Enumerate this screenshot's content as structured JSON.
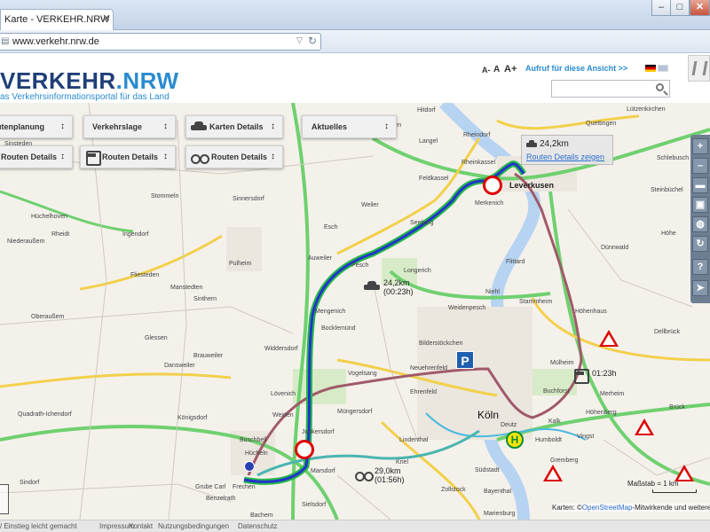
{
  "browser": {
    "tab_title": "Karte - VERKEHR.NRW",
    "tab_close": "✕",
    "url": "www.verkehr.nrw.de",
    "window_buttons": {
      "minimize": "–",
      "maximize": "□",
      "close": "✕"
    }
  },
  "header": {
    "logo_main": "VERKEHR",
    "logo_accent": ".NRW",
    "logo_sub": "as Verkehrsinformationsportal für das Land",
    "font_sizes": [
      "A-",
      "A",
      "A+"
    ],
    "view_link": "Aufruf für diese Ansicht >>",
    "languages": [
      "de",
      "en"
    ],
    "search": {
      "placeholder": "",
      "value": ""
    }
  },
  "panels": {
    "routenplanung": "ıtenplanung",
    "verkehrslage": "Verkehrslage",
    "karten_details": "Karten Details",
    "aktuelles": "Aktuelles",
    "routen_details_car": "Routen Details",
    "routen_details_bus": "Routen Details",
    "routen_details_bike": "Routen Details",
    "toggle_arrow": "↕"
  },
  "route": {
    "tooltip_distance": "24,2km",
    "tooltip_link": "Routen Details zeigen",
    "car_distance": "24,2km",
    "car_time": "(00:23h)",
    "transit_time": "01:23h",
    "bike_distance": "29,0km",
    "bike_time": "(01:56h)"
  },
  "toolbar": [
    "+",
    "–",
    "car",
    "bus",
    "globe",
    "↻",
    "?",
    "➤"
  ],
  "map": {
    "places": {
      "leverkusen": "Leverkusen",
      "koeln": "Köln",
      "merkenich": "Merkenich",
      "niehl": "Niehl",
      "muelheim": "Mülheim",
      "deutz": "Deutz",
      "kalk": "Kalk",
      "ehrenfeld": "Ehrenfeld",
      "lindenthal": "Lindenthal",
      "suedstadt": "Südstadt",
      "bayenthal": "Bayenthal",
      "marienburg": "Marienburg",
      "zollstock": "Zollstock",
      "pulheim": "Pulheim",
      "bocklemuend": "Bocklemünd",
      "mengenich": "Mengenich",
      "vogelsang": "Vogelsang",
      "muengersdorf": "Müngersdorf",
      "junkersdorf": "Junkersdorf",
      "loevenich": "Lövenich",
      "weiden": "Weiden",
      "marsdorf": "Marsdorf",
      "frechen": "Frechen",
      "huerth": "Hürth",
      "buchforst": "Buchforst",
      "humboldt": "Humboldt",
      "vingst": "Vingst",
      "gremberg": "Gremberg",
      "hoehenberg": "Höhenberg",
      "dellbrueck": "Dellbrück",
      "brueck": "Brück",
      "stammheim": "Stammheim",
      "flittard": "Flittard",
      "duennwald": "Dünnwald",
      "schlebusch": "Schlebusch",
      "hitdorf": "Hitdorf",
      "rheindorf": "Rheindorf",
      "rheinkassel": "Rheinkassel",
      "feldkassel": "Feldkassel",
      "langel": "Langel",
      "worringen": "Worringen",
      "weiler": "Weiler",
      "esch": "Esch",
      "pesch": "Pesch",
      "longerich": "Longerich",
      "seeberg": "Seeberg",
      "auweiler": "Auweiler",
      "weidenpesch": "Weidenpesch",
      "bilderstoeckchen": "Bilderstöckchen",
      "neuehrenfeld": "Neuehrenfeld",
      "hoehenhaus": "Höhenhaus",
      "merheim": "Merheim",
      "widdersdorf": "Widdersdorf",
      "brauweiler": "Brauweiler",
      "dansweiler": "Dansweiler",
      "glessen": "Glessen",
      "sinthern": "Sinthern",
      "manstedten": "Manstedten",
      "fliesteden": "Fliesteden",
      "ingendorf": "Ingendorf",
      "sinnersdorf": "Sinnersdorf",
      "stommeln": "Stommeln",
      "huechelhoven": "Hüchelhoven",
      "rheidt": "Rheidt",
      "oberaussem": "Oberaußem",
      "niederaussem": "Niederaußem",
      "koenigsdorf": "Königsdorf",
      "grube_carl": "Grube Carl",
      "benzelrath": "Benzelrath",
      "sindorf": "Sindorf",
      "quadrath": "Quadrath-Ichendorf",
      "buschbell": "Buschbell",
      "huecheln": "Hücheln",
      "bachem": "Bachem",
      "sielsdorf": "Sielsdorf",
      "kriel": "Kriel",
      "quettingen": "Quettingen",
      "luetzenkirchen": "Lützenkirchen",
      "steinbuechel": "Steinbüchel",
      "hoehe": "Höhe",
      "sinsteden": "Sinsteden"
    }
  },
  "scale": {
    "text": "Maßstab = 1 km"
  },
  "attribution": {
    "prefix": "Karten: ©",
    "link": "OpenStreetMap",
    "suffix": "-Mitwirkende und weitere s"
  },
  "footer": {
    "links": [
      "/ Einstieg leicht gemacht",
      "Impressum",
      "Kontakt",
      "Nutzungsbedingungen",
      "Datenschutz"
    ]
  },
  "colors": {
    "logo": "#1f3f78",
    "accent": "#2a8bd0",
    "route_car": "#2233cc",
    "route_car_outline": "#27b84a",
    "route_transit": "#a05a6a",
    "route_bike": "#4ab5b0",
    "motorway": "#6fd06f",
    "primary_road": "#f2d04a",
    "water": "#b7d3f2"
  }
}
